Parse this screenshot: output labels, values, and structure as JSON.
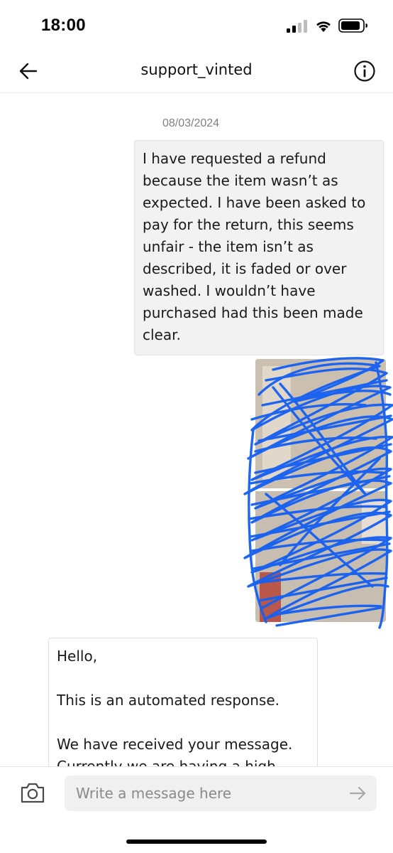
{
  "status_bar": {
    "time": "18:00",
    "icons": [
      "cellular-signal-icon",
      "wifi-icon",
      "battery-icon"
    ]
  },
  "header": {
    "title": "support_vinted",
    "back_icon": "arrow-left-icon",
    "info_icon": "info-circle-icon"
  },
  "conversation": {
    "date": "08/03/2024",
    "outgoing_message": "I have requested a refund because the item wasn’t as expected. I have been asked to pay for the return, this seems unfair - the item isn’t as described, it is faded or over washed. I wouldn’t have purchased had this been made clear.",
    "attachment_icon": "photo-icon",
    "incoming_message": {
      "line1": "Hello,",
      "line2": "This is an automated response.",
      "line3": "We have received your message. Currently we are having a high"
    }
  },
  "composer": {
    "placeholder": "Write a message here",
    "camera_icon": "camera-icon",
    "send_icon": "arrow-right-icon"
  },
  "colors": {
    "scribble": "#1560f2",
    "outgoing_bubble": "#f2f2f2",
    "input_background": "#f0f0f0",
    "date_text": "#808080"
  }
}
